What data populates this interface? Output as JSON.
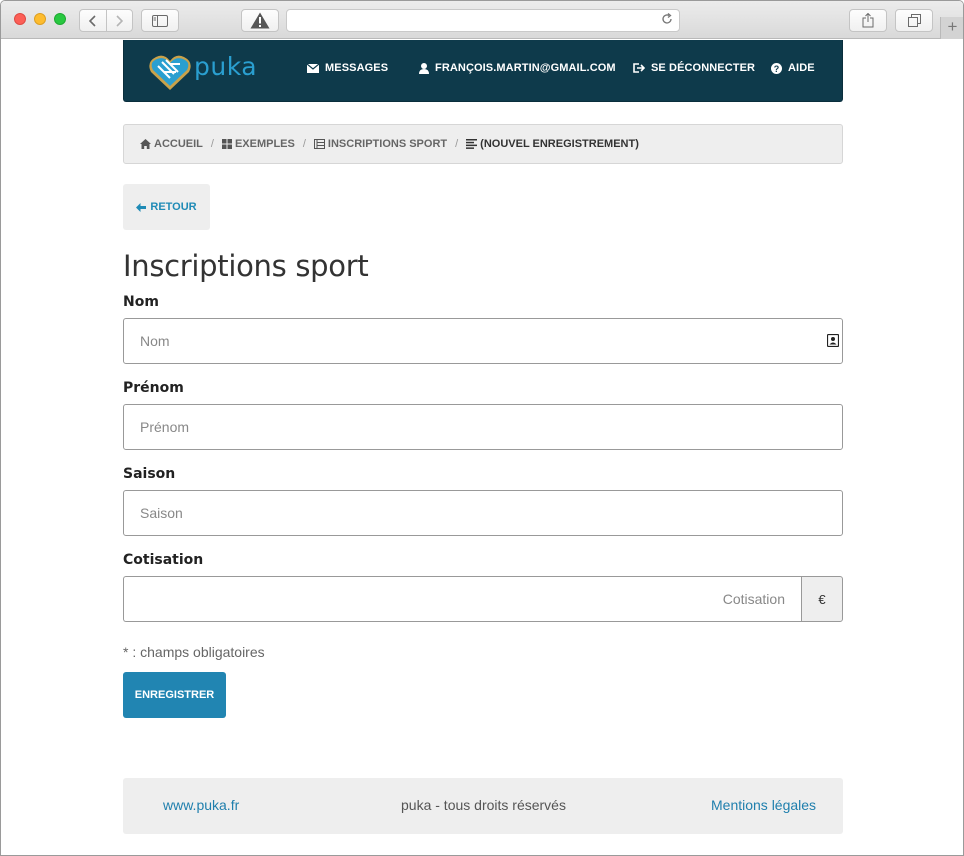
{
  "browser": {
    "nav_back": "<",
    "nav_forward": ">"
  },
  "site": {
    "logo_text": "puka",
    "nav": {
      "messages": "MESSAGES",
      "user": "FRANÇOIS.MARTIN@GMAIL.COM",
      "logout": "SE DÉCONNECTER",
      "help": "AIDE"
    }
  },
  "breadcrumb": [
    {
      "label": "ACCUEIL",
      "icon": "home-icon"
    },
    {
      "label": "EXEMPLES",
      "icon": "grid-icon"
    },
    {
      "label": "INSCRIPTIONS SPORT",
      "icon": "list-icon"
    },
    {
      "label": "(NOUVEL ENREGISTREMENT)",
      "icon": "lines-icon"
    }
  ],
  "breadcrumb_sep": "/",
  "back_button": "RETOUR",
  "title": "Inscriptions sport",
  "form": {
    "nom": {
      "label": "Nom",
      "placeholder": "Nom",
      "value": ""
    },
    "prenom": {
      "label": "Prénom",
      "placeholder": "Prénom",
      "value": ""
    },
    "saison": {
      "label": "Saison",
      "placeholder": "Saison",
      "value": ""
    },
    "cotisation": {
      "label": "Cotisation",
      "placeholder": "Cotisation",
      "value": "",
      "addon": "€"
    }
  },
  "required_note": "* : champs obligatoires",
  "save_button": "ENREGISTRER",
  "footer": {
    "site_link": "www.puka.fr",
    "copyright": "puka - tous droits réservés",
    "legal_link": "Mentions légales"
  },
  "colors": {
    "header_bg": "#0e3a4b",
    "accent": "#2185b2",
    "link": "#1f7fad"
  }
}
